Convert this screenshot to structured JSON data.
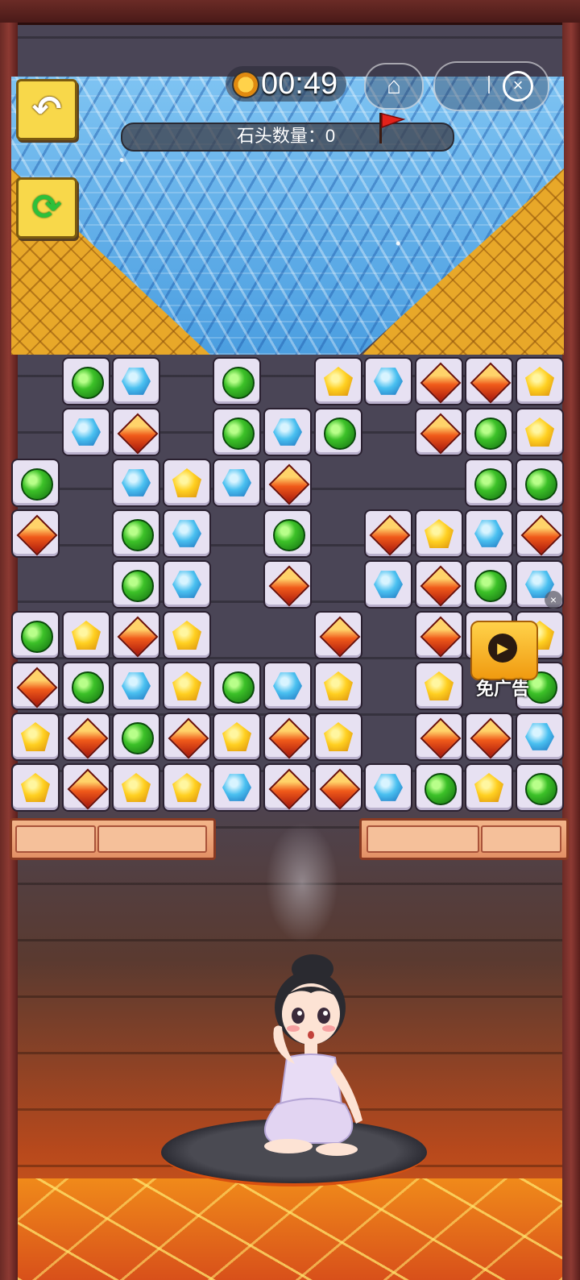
{
  "hud": {
    "timer": "00:49",
    "stone_count_label": "石头数量：",
    "stone_count_value": "0",
    "home_icon": "home-icon",
    "close_icon": "close-circle-icon"
  },
  "side_buttons": {
    "undo_icon": "undo-arrow-icon",
    "refresh_icon": "refresh-icon"
  },
  "ad": {
    "label": "免广告",
    "close_symbol": "×"
  },
  "gem_colors": {
    "green": "#3cc128",
    "blue": "#4ac0f0",
    "red": "#f05a1a",
    "yellow": "#ffd021"
  },
  "gem_grid": {
    "columns": 11,
    "rows": [
      [
        "",
        "green",
        "blue",
        "",
        "green",
        "",
        "yellow",
        "blue",
        "red",
        "red",
        "yellow"
      ],
      [
        "",
        "blue",
        "red",
        "",
        "green",
        "blue",
        "green",
        "",
        "red",
        "green",
        "yellow"
      ],
      [
        "green",
        "",
        "blue",
        "yellow",
        "blue",
        "red",
        "",
        "",
        "",
        "green",
        "green"
      ],
      [
        "red",
        "",
        "green",
        "blue",
        "",
        "green",
        "",
        "red",
        "yellow",
        "blue",
        "red"
      ],
      [
        "",
        "",
        "green",
        "blue",
        "",
        "red",
        "",
        "blue",
        "red",
        "green",
        "blue"
      ],
      [
        "green",
        "yellow",
        "red",
        "yellow",
        "",
        "",
        "red",
        "",
        "red",
        "green",
        "yellow"
      ],
      [
        "red",
        "green",
        "blue",
        "yellow",
        "green",
        "blue",
        "yellow",
        "",
        "yellow",
        "",
        "green"
      ],
      [
        "yellow",
        "red",
        "green",
        "red",
        "yellow",
        "red",
        "yellow",
        "",
        "red",
        "red",
        "blue"
      ],
      [
        "yellow",
        "red",
        "yellow",
        "yellow",
        "blue",
        "red",
        "red",
        "blue",
        "green",
        "yellow",
        "green"
      ]
    ]
  }
}
